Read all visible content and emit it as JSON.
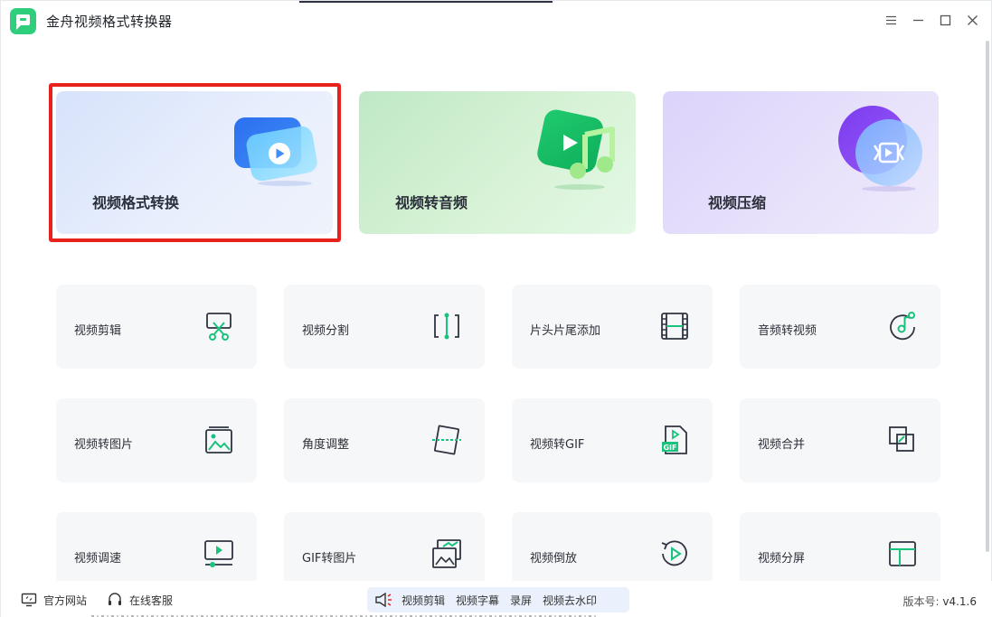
{
  "window": {
    "title": "金舟视频格式转换器"
  },
  "controls": {
    "menu": "menu-icon",
    "minimize": "minimize-icon",
    "maximize": "maximize-icon",
    "close": "close-icon"
  },
  "features": [
    {
      "label": "视频格式转换",
      "icon": "video-convert-icon"
    },
    {
      "label": "视频转音频",
      "icon": "video-to-audio-icon"
    },
    {
      "label": "视频压缩",
      "icon": "video-compress-icon"
    }
  ],
  "tools": [
    {
      "label": "视频剪辑",
      "icon": "scissors-icon"
    },
    {
      "label": "视频分割",
      "icon": "split-icon"
    },
    {
      "label": "片头片尾添加",
      "icon": "film-strip-icon"
    },
    {
      "label": "音频转视频",
      "icon": "music-disc-icon"
    },
    {
      "label": "视频转图片",
      "icon": "image-icon"
    },
    {
      "label": "角度调整",
      "icon": "rotate-frame-icon"
    },
    {
      "label": "视频转GIF",
      "icon": "gif-file-icon"
    },
    {
      "label": "视频合并",
      "icon": "merge-icon"
    },
    {
      "label": "视频调速",
      "icon": "speed-icon"
    },
    {
      "label": "GIF转图片",
      "icon": "gif-to-image-icon"
    },
    {
      "label": "视频倒放",
      "icon": "reverse-play-icon"
    },
    {
      "label": "视频分屏",
      "icon": "split-screen-icon"
    }
  ],
  "bottom": {
    "website": "官方网站",
    "support": "在线客服",
    "promo": [
      "视频剪辑",
      "视频字幕",
      "录屏",
      "视频去水印"
    ],
    "version_label": "版本号:",
    "version": "v4.1.6"
  },
  "colors": {
    "accent": "#2fce7d",
    "highlight": "#e8211d",
    "icon_green": "#19c37d",
    "icon_dark": "#2f3440"
  }
}
